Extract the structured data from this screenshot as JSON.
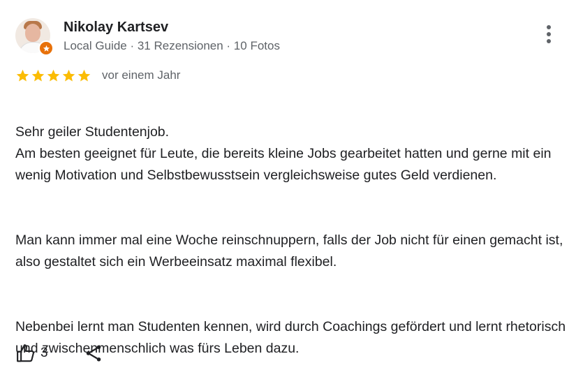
{
  "review": {
    "author": {
      "name": "Nikolay Kartsev",
      "meta": "Local Guide · 31 Rezensionen · 10 Fotos",
      "badge_color": "#e8710a"
    },
    "rating": 5,
    "rating_max": 5,
    "star_color": "#fbbc04",
    "time": "vor einem Jahr",
    "paragraphs": [
      "Sehr geiler Studentenjob.\nAm besten geeignet für Leute, die bereits kleine Jobs gearbeitet hatten und gerne mit ein wenig Motivation und Selbstbewusstsein vergleichsweise gutes Geld verdienen.",
      "Man kann immer mal eine Woche reinschnuppern, falls der Job nicht für einen gemacht ist, also gestaltet sich ein Werbeeinsatz maximal flexibel.",
      "Nebenbei lernt man Studenten kennen, wird durch Coachings gefördert und lernt rhetorisch und zwischenmenschlich was fürs Leben dazu."
    ],
    "actions": {
      "like_icon": "thumbs-up-icon",
      "like_count": "3",
      "share_icon": "share-icon",
      "menu_icon": "more-vert-icon"
    }
  }
}
